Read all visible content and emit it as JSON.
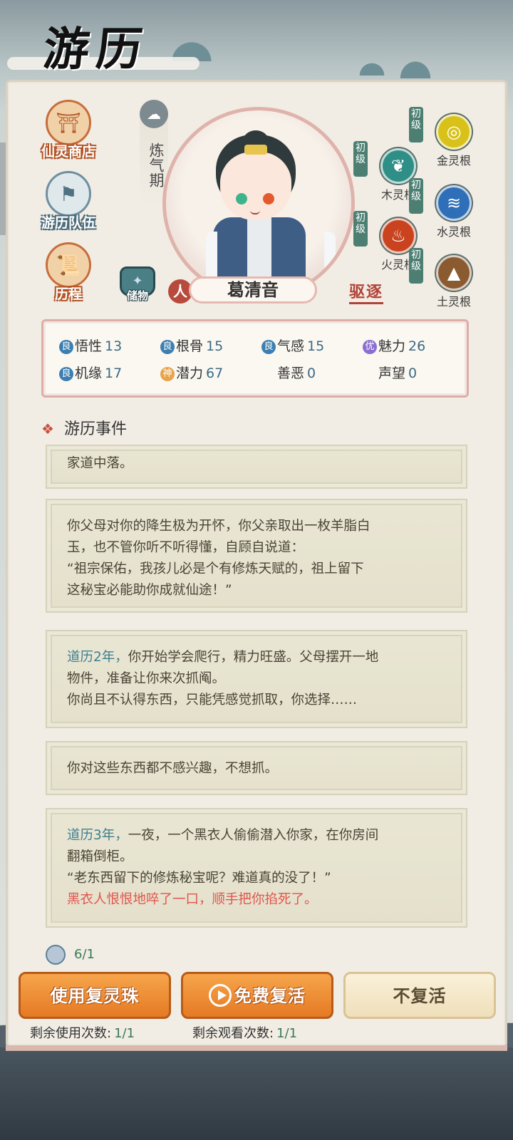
{
  "title": "游历",
  "menu": [
    {
      "label": "仙灵商店",
      "icon": "shop-icon"
    },
    {
      "label": "游历队伍",
      "icon": "team-icon"
    },
    {
      "label": "历程",
      "icon": "scroll-icon"
    }
  ],
  "character": {
    "stage": "炼气期",
    "race": "人",
    "name": "葛清音",
    "storage_label": "储物",
    "expel_label": "驱逐"
  },
  "spirit_roots": [
    {
      "level": "初级",
      "label": "金灵根",
      "color": "#d8c21a"
    },
    {
      "level": "初级",
      "label": "木灵根",
      "color": "#2f8f86"
    },
    {
      "level": "初级",
      "label": "水灵根",
      "color": "#2f6fb8"
    },
    {
      "level": "初级",
      "label": "火灵根",
      "color": "#c9431f"
    },
    {
      "level": "初级",
      "label": "土灵根",
      "color": "#8a5a30"
    }
  ],
  "stats": [
    {
      "grade": "良",
      "grade_color": "#3d7fb0",
      "label": "悟性",
      "value": "13"
    },
    {
      "grade": "良",
      "grade_color": "#3d7fb0",
      "label": "根骨",
      "value": "15"
    },
    {
      "grade": "良",
      "grade_color": "#3d7fb0",
      "label": "气感",
      "value": "15"
    },
    {
      "grade": "优",
      "grade_color": "#8a6fd0",
      "label": "魅力",
      "value": "26"
    },
    {
      "grade": "良",
      "grade_color": "#3d7fb0",
      "label": "机缘",
      "value": "17"
    },
    {
      "grade": "神",
      "grade_color": "#e9a34a",
      "label": "潜力",
      "value": "67"
    },
    {
      "grade": "",
      "grade_color": "",
      "label": "善恶",
      "value": "0"
    },
    {
      "grade": "",
      "grade_color": "",
      "label": "声望",
      "value": "0"
    }
  ],
  "events_title": "游历事件",
  "events": [
    {
      "lines": [
        "家道中落。"
      ]
    },
    {
      "lines": [
        "你父母对你的降生极为开怀，你父亲取出一枚羊脂白",
        "玉，也不管你听不听得懂，自顾自说道：",
        "“祖宗保佑，我孩儿必是个有修炼天赋的，祖上留下",
        "这秘宝必能助你成就仙途！”"
      ]
    },
    {
      "highlight": "道历2年，",
      "lines": [
        "你开始学会爬行，精力旺盛。父母摆开一地",
        "物件，准备让你来次抓阄。",
        "你尚且不认得东西，只能凭感觉抓取，你选择……"
      ]
    },
    {
      "lines": [
        "你对这些东西都不感兴趣，不想抓。"
      ]
    },
    {
      "highlight": "道历3年，",
      "lines": [
        "一夜，一个黑衣人偷偷潜入你家，在你房间",
        "翻箱倒柜。",
        "“老东西留下的修炼秘宝呢？难道真的没了！”"
      ],
      "red": "黑衣人恨恨地啐了一口，顺手把你掐死了。"
    }
  ],
  "revive_count": "6/1",
  "buttons": {
    "use_pearl": "使用复灵珠",
    "free_revive": "免费复活",
    "no_revive": "不复活"
  },
  "remaining": {
    "use_label": "剩余使用次数:",
    "use_value": "1/1",
    "watch_label": "剩余观看次数:",
    "watch_value": "1/1"
  }
}
